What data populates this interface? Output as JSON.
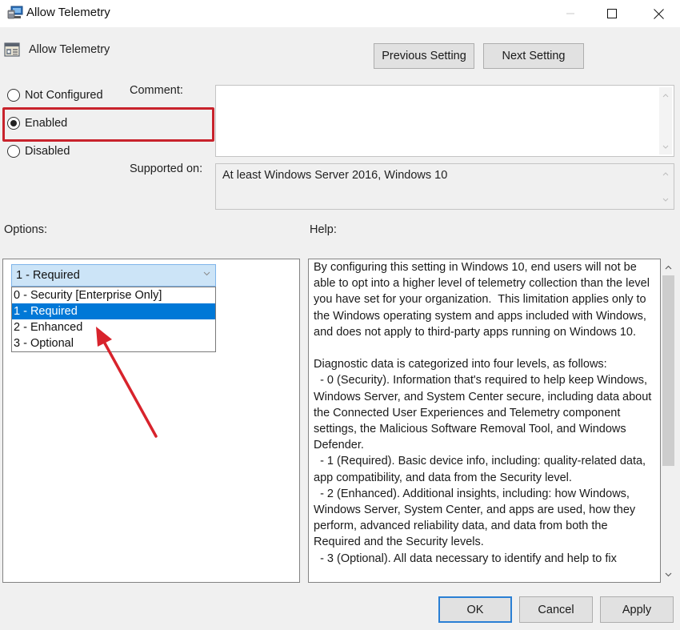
{
  "window": {
    "title": "Allow Telemetry",
    "controls": {
      "minimize": "minimize",
      "maximize": "maximize",
      "close": "close"
    }
  },
  "header": {
    "setting_name": "Allow Telemetry",
    "previous_button": "Previous Setting",
    "next_button": "Next Setting"
  },
  "state": {
    "options": [
      {
        "label": "Not Configured",
        "checked": false
      },
      {
        "label": "Enabled",
        "checked": true
      },
      {
        "label": "Disabled",
        "checked": false
      }
    ]
  },
  "comment": {
    "label": "Comment:",
    "value": ""
  },
  "supported": {
    "label": "Supported on:",
    "value": "At least Windows Server 2016, Windows 10"
  },
  "options_section": {
    "label": "Options:",
    "combo_value": "1 - Required",
    "dropdown_items": [
      "0 - Security [Enterprise Only]",
      "1 - Required",
      "2 - Enhanced",
      "3 - Optional"
    ],
    "selected_index": 1
  },
  "help_section": {
    "label": "Help:",
    "text": "By configuring this setting in Windows 10, end users will not be able to opt into a higher level of telemetry collection than the level you have set for your organization.  This limitation applies only to the Windows operating system and apps included with Windows, and does not apply to third-party apps running on Windows 10.\n\nDiagnostic data is categorized into four levels, as follows:\n  - 0 (Security). Information that's required to help keep Windows, Windows Server, and System Center secure, including data about the Connected User Experiences and Telemetry component settings, the Malicious Software Removal Tool, and Windows Defender.\n  - 1 (Required). Basic device info, including: quality-related data, app compatibility, and data from the Security level.\n  - 2 (Enhanced). Additional insights, including: how Windows, Windows Server, System Center, and apps are used, how they perform, advanced reliability data, and data from both the Required and the Security levels.\n  - 3 (Optional). All data necessary to identify and help to fix"
  },
  "footer": {
    "ok": "OK",
    "cancel": "Cancel",
    "apply": "Apply"
  },
  "annotation": {
    "color": "#c8232c"
  }
}
